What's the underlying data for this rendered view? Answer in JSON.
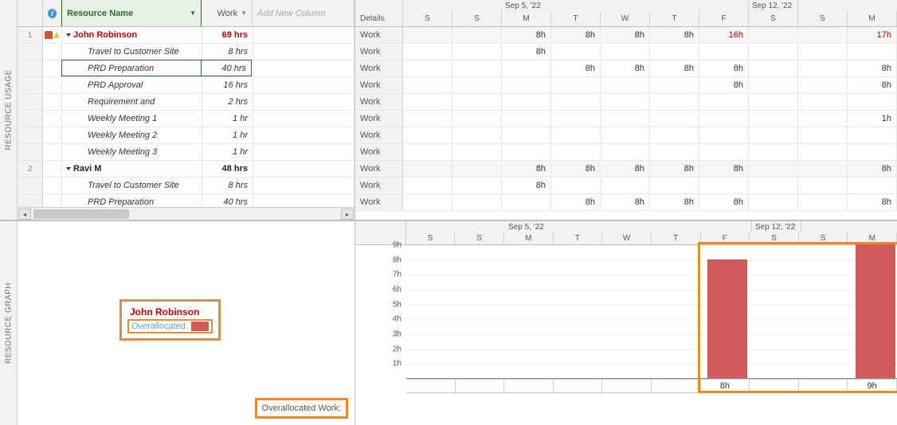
{
  "vlabels": {
    "top": "RESOURCE USAGE",
    "bottom": "RESOURCE GRAPH"
  },
  "columns": {
    "info_icon": "i",
    "name": "Resource Name",
    "work": "Work",
    "add": "Add New Column"
  },
  "rows": [
    {
      "num": "1",
      "type": "resource",
      "color": "red",
      "name": "John Robinson",
      "work": "69 hrs",
      "ind": "person",
      "selected": false,
      "daily": [
        "",
        "",
        "8h",
        "8h",
        "8h",
        "8h",
        "16h",
        "",
        "",
        "17h"
      ],
      "over": [
        false,
        false,
        false,
        false,
        false,
        false,
        true,
        false,
        false,
        true
      ]
    },
    {
      "type": "task",
      "name": "Travel to Customer Site",
      "work": "8 hrs",
      "daily": [
        "",
        "",
        "8h",
        "",
        "",
        "",
        "",
        "",
        "",
        ""
      ]
    },
    {
      "type": "task",
      "name": "PRD Preparation",
      "work": "40 hrs",
      "selected": true,
      "daily": [
        "",
        "",
        "",
        "8h",
        "8h",
        "8h",
        "8h",
        "",
        "",
        "8h"
      ]
    },
    {
      "type": "task",
      "name": "PRD Approval",
      "work": "16 hrs",
      "daily": [
        "",
        "",
        "",
        "",
        "",
        "",
        "8h",
        "",
        "",
        "8h"
      ]
    },
    {
      "type": "task",
      "name": "Requirement and",
      "work": "2 hrs",
      "daily": [
        "",
        "",
        "",
        "",
        "",
        "",
        "",
        "",
        "",
        ""
      ]
    },
    {
      "type": "task",
      "name": "Weekly Meeting 1",
      "work": "1 hr",
      "daily": [
        "",
        "",
        "",
        "",
        "",
        "",
        "",
        "",
        "",
        "1h"
      ]
    },
    {
      "type": "task",
      "name": "Weekly Meeting 2",
      "work": "1 hr",
      "daily": [
        "",
        "",
        "",
        "",
        "",
        "",
        "",
        "",
        "",
        ""
      ]
    },
    {
      "type": "task",
      "name": "Weekly Meeting 3",
      "work": "1 hr",
      "daily": [
        "",
        "",
        "",
        "",
        "",
        "",
        "",
        "",
        "",
        ""
      ]
    },
    {
      "num": "2",
      "type": "resource",
      "color": "black",
      "name": "Ravi M",
      "work": "48 hrs",
      "daily": [
        "",
        "",
        "8h",
        "8h",
        "8h",
        "8h",
        "8h",
        "",
        "",
        "8h"
      ]
    },
    {
      "type": "task",
      "name": "Travel to Customer Site",
      "work": "8 hrs",
      "daily": [
        "",
        "",
        "8h",
        "",
        "",
        "",
        "",
        "",
        "",
        ""
      ]
    },
    {
      "type": "task",
      "name": "PRD Preparation",
      "work": "40 hrs",
      "daily": [
        "",
        "",
        "",
        "8h",
        "8h",
        "8h",
        "8h",
        "",
        "",
        "8h"
      ]
    }
  ],
  "timescale": {
    "weeks": [
      {
        "label": "Sep 5, '22",
        "span": 7
      },
      {
        "label": "Sep 12, '22",
        "span": 1
      }
    ],
    "days_top": [
      "S",
      "S",
      "M",
      "T",
      "W",
      "T",
      "F",
      "S",
      "S",
      "M"
    ],
    "details_label": "Details",
    "work_label": "Work"
  },
  "legend": {
    "resource": "John Robinson",
    "overallocated_label": "Overallocated:",
    "overallocated_work_label": "Overallocated Work:"
  },
  "chart_data": {
    "type": "bar",
    "title": "Overallocated Work",
    "categories": [
      "S",
      "S",
      "M",
      "T",
      "W",
      "T",
      "F",
      "S",
      "S",
      "M"
    ],
    "values": [
      0,
      0,
      0,
      0,
      0,
      0,
      8,
      0,
      0,
      9
    ],
    "value_labels": [
      "",
      "",
      "",
      "",
      "",
      "",
      "8h",
      "",
      "",
      "9h"
    ],
    "ylabel": "",
    "ylim": [
      0,
      9
    ],
    "yticks": [
      "1h",
      "2h",
      "3h",
      "4h",
      "5h",
      "6h",
      "7h",
      "8h",
      "9h"
    ],
    "weeks": [
      {
        "label": "Sep 5, '22",
        "span": 7
      },
      {
        "label": "Sep 12, '22",
        "span": 1
      }
    ]
  }
}
